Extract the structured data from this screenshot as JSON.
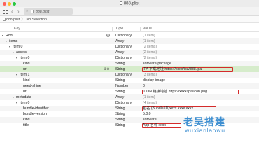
{
  "window": {
    "title": "888.plist"
  },
  "tab": {
    "label": "888.plist",
    "close": "×"
  },
  "breadcrumb": {
    "file": "888.plist",
    "separator": "〉",
    "selection": "No Selection"
  },
  "columns": {
    "key": "Key",
    "type": "Type",
    "value": "Value"
  },
  "rows": [
    {
      "key": "Root",
      "type": "Dictionary",
      "value": "(1 item)"
    },
    {
      "key": "items",
      "type": "Array",
      "value": "(1 item)"
    },
    {
      "key": "Item 0",
      "type": "Dictionary",
      "value": "(2 items)"
    },
    {
      "key": "assets",
      "type": "Array",
      "value": "(2 items)"
    },
    {
      "key": "Item 0",
      "type": "Dictionary",
      "value": "(2 items)"
    },
    {
      "key": "kind",
      "type": "String",
      "value": "software-package"
    },
    {
      "key": "url",
      "type": "String",
      "value": "IPA 下载地址 https://xxxx/ipa/888.ipa"
    },
    {
      "key": "Item 1",
      "type": "Dictionary",
      "value": "(3 items)"
    },
    {
      "key": "kind",
      "type": "String",
      "value": "display-image"
    },
    {
      "key": "need-shine",
      "type": "Number",
      "value": "0"
    },
    {
      "key": "url",
      "type": "String",
      "value": "ICON 链接地址 https://xxxx/ipa/icon.png"
    },
    {
      "key": "metadata",
      "type": "Array",
      "value": "(1 item)"
    },
    {
      "key": "Item 0",
      "type": "Dictionary",
      "value": "(4 items)"
    },
    {
      "key": "bundle-identifier",
      "type": "String",
      "value": "包名 (Bundle ID)xxxx.xxxx.xxxx"
    },
    {
      "key": "bundle-version",
      "type": "String",
      "value": "5.0.0"
    },
    {
      "key": "kind",
      "type": "String",
      "value": "software"
    },
    {
      "key": "title",
      "type": "String",
      "value": "App 名称 xxxx"
    }
  ],
  "row_controls": {
    "add": "⊕",
    "remove": "⊖",
    "stepper": "◇"
  },
  "watermark": {
    "top": "老吴搭建",
    "bottom": "wuxianlaowu"
  },
  "colors": {
    "selection": "#d6eccb",
    "highlight_box": "#d42b2b",
    "watermark": "#3e8fd1"
  }
}
